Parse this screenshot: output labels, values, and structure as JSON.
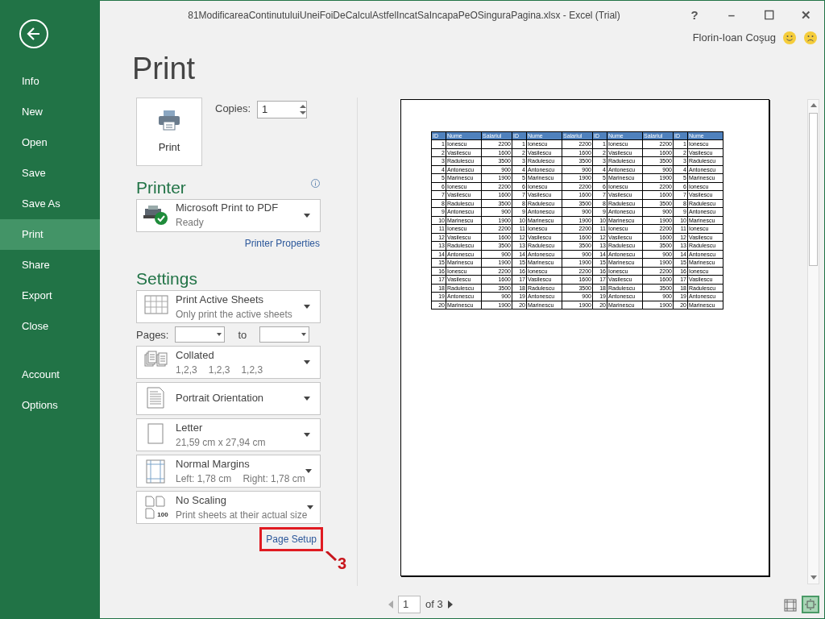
{
  "window": {
    "title": "81ModificareaContinutuluiUneiFoiDeCalculAstfelIncatSaIncapaPeOSinguraPagina.xlsx - Excel (Trial)",
    "user": "Florin-Ioan Coşug",
    "controls": [
      "?",
      "–",
      "☐",
      "✕"
    ]
  },
  "nav_main": [
    {
      "label": "Info",
      "selected": false
    },
    {
      "label": "New",
      "selected": false
    },
    {
      "label": "Open",
      "selected": false
    },
    {
      "label": "Save",
      "selected": false
    },
    {
      "label": "Save As",
      "selected": false
    },
    {
      "label": "Print",
      "selected": true
    },
    {
      "label": "Share",
      "selected": false
    },
    {
      "label": "Export",
      "selected": false
    },
    {
      "label": "Close",
      "selected": false
    }
  ],
  "nav_account": [
    {
      "label": "Account",
      "selected": false
    },
    {
      "label": "Options",
      "selected": false
    }
  ],
  "page_title": "Print",
  "print_button": {
    "label": "Print"
  },
  "copies": {
    "label": "Copies:",
    "value": "1"
  },
  "printer": {
    "heading": "Printer",
    "name": "Microsoft Print to PDF",
    "status": "Ready",
    "properties_link": "Printer Properties"
  },
  "settings": {
    "heading": "Settings",
    "items": [
      {
        "kind": "dropdown",
        "title": "Print Active Sheets",
        "subtitle": [
          "Only print the active sheets"
        ]
      },
      {
        "kind": "pages",
        "label": "Pages:",
        "to_label": "to"
      },
      {
        "kind": "dropdown",
        "title": "Collated",
        "subtitle": [
          "1,2,3",
          "1,2,3",
          "1,2,3"
        ]
      },
      {
        "kind": "dropdown",
        "title": "Portrait Orientation"
      },
      {
        "kind": "dropdown",
        "title": "Letter",
        "subtitle": [
          "21,59 cm x 27,94 cm"
        ]
      },
      {
        "kind": "dropdown",
        "title": "Normal Margins",
        "subtitle": [
          "Left:  1,78 cm",
          "Right:  1,78 cm"
        ]
      },
      {
        "kind": "dropdown",
        "title": "No Scaling",
        "subtitle": [
          "Print sheets at their actual size"
        ]
      }
    ],
    "scaling_label": "100"
  },
  "page_setup_link": "Page Setup",
  "annotation": "3",
  "preview": {
    "columns": [
      "ID",
      "Nume",
      "Salariul",
      "ID",
      "Nume",
      "Salariul",
      "ID",
      "Nume",
      "Salariul",
      "ID",
      "Nume"
    ],
    "rows": [
      [
        "1",
        "Ionescu",
        "2200",
        "1",
        "Ionescu",
        "2200",
        "1",
        "Ionescu",
        "2200",
        "1",
        "Ionescu"
      ],
      [
        "2",
        "Vasilescu",
        "1600",
        "2",
        "Vasilescu",
        "1600",
        "2",
        "Vasilescu",
        "1600",
        "2",
        "Vasilescu"
      ],
      [
        "3",
        "Radulescu",
        "3500",
        "3",
        "Radulescu",
        "3500",
        "3",
        "Radulescu",
        "3500",
        "3",
        "Radulescu"
      ],
      [
        "4",
        "Antonescu",
        "900",
        "4",
        "Antonescu",
        "900",
        "4",
        "Antonescu",
        "900",
        "4",
        "Antonescu"
      ],
      [
        "5",
        "Marinescu",
        "1900",
        "5",
        "Marinescu",
        "1900",
        "5",
        "Marinescu",
        "1900",
        "5",
        "Marinescu"
      ],
      [
        "6",
        "Ionescu",
        "2200",
        "6",
        "Ionescu",
        "2200",
        "6",
        "Ionescu",
        "2200",
        "6",
        "Ionescu"
      ],
      [
        "7",
        "Vasilescu",
        "1600",
        "7",
        "Vasilescu",
        "1600",
        "7",
        "Vasilescu",
        "1600",
        "7",
        "Vasilescu"
      ],
      [
        "8",
        "Radulescu",
        "3500",
        "8",
        "Radulescu",
        "3500",
        "8",
        "Radulescu",
        "3500",
        "8",
        "Radulescu"
      ],
      [
        "9",
        "Antonescu",
        "900",
        "9",
        "Antonescu",
        "900",
        "9",
        "Antonescu",
        "900",
        "9",
        "Antonescu"
      ],
      [
        "10",
        "Marinescu",
        "1900",
        "10",
        "Marinescu",
        "1900",
        "10",
        "Marinescu",
        "1900",
        "10",
        "Marinescu"
      ],
      [
        "11",
        "Ionescu",
        "2200",
        "11",
        "Ionescu",
        "2200",
        "11",
        "Ionescu",
        "2200",
        "11",
        "Ionescu"
      ],
      [
        "12",
        "Vasilescu",
        "1600",
        "12",
        "Vasilescu",
        "1600",
        "12",
        "Vasilescu",
        "1600",
        "12",
        "Vasilescu"
      ],
      [
        "13",
        "Radulescu",
        "3500",
        "13",
        "Radulescu",
        "3500",
        "13",
        "Radulescu",
        "3500",
        "13",
        "Radulescu"
      ],
      [
        "14",
        "Antonescu",
        "900",
        "14",
        "Antonescu",
        "900",
        "14",
        "Antonescu",
        "900",
        "14",
        "Antonescu"
      ],
      [
        "15",
        "Marinescu",
        "1900",
        "15",
        "Marinescu",
        "1900",
        "15",
        "Marinescu",
        "1900",
        "15",
        "Marinescu"
      ],
      [
        "16",
        "Ionescu",
        "2200",
        "16",
        "Ionescu",
        "2200",
        "16",
        "Ionescu",
        "2200",
        "16",
        "Ionescu"
      ],
      [
        "17",
        "Vasilescu",
        "1600",
        "17",
        "Vasilescu",
        "1600",
        "17",
        "Vasilescu",
        "1600",
        "17",
        "Vasilescu"
      ],
      [
        "18",
        "Radulescu",
        "3500",
        "18",
        "Radulescu",
        "3500",
        "18",
        "Radulescu",
        "3500",
        "18",
        "Radulescu"
      ],
      [
        "19",
        "Antonescu",
        "900",
        "19",
        "Antonescu",
        "900",
        "19",
        "Antonescu",
        "900",
        "19",
        "Antonescu"
      ],
      [
        "20",
        "Marinescu",
        "1900",
        "20",
        "Marinescu",
        "1900",
        "20",
        "Marinescu",
        "1900",
        "20",
        "Marinescu"
      ]
    ],
    "current_page": "1",
    "page_count": "of 3"
  }
}
